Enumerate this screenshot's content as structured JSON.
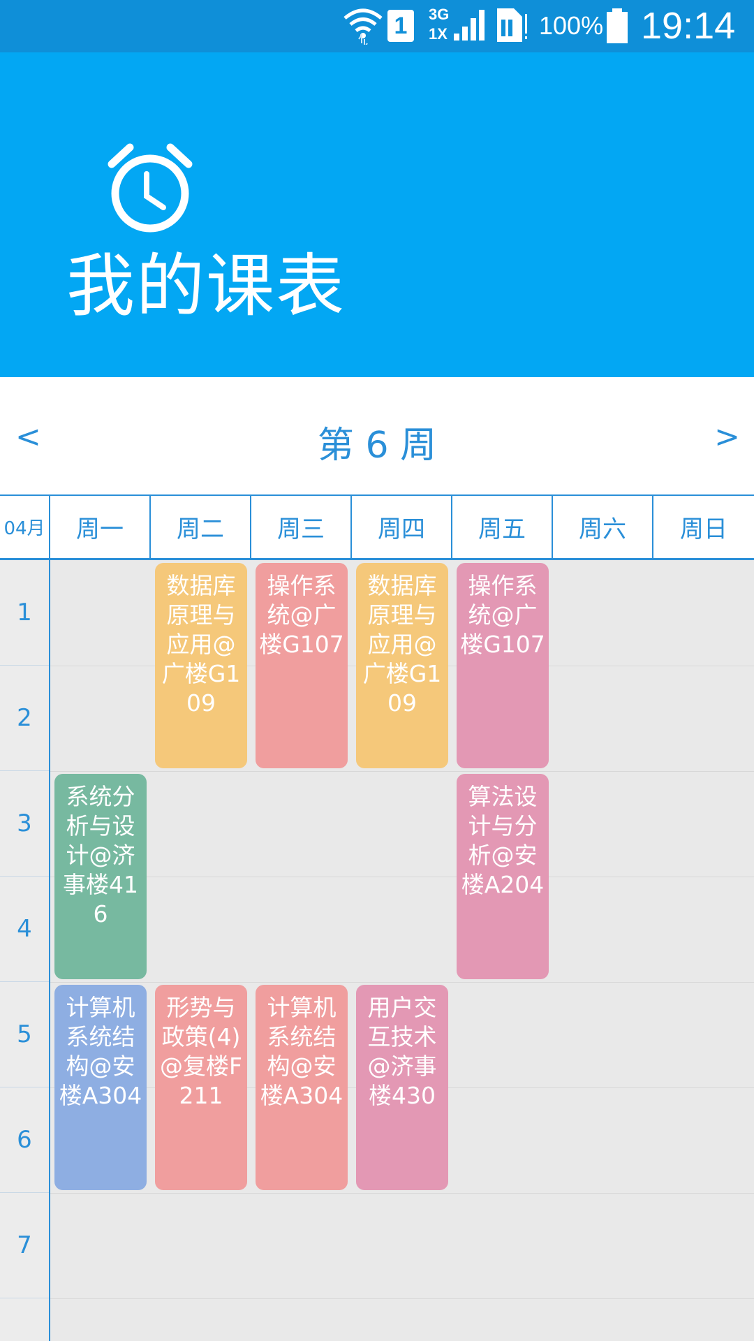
{
  "status_bar": {
    "sim_slot": "1",
    "net_top": "3G",
    "net_bottom": "1X",
    "battery": "100%",
    "time": "19:14"
  },
  "header": {
    "title": "我的课表",
    "icon": "alarm-clock-icon",
    "background": "#03a7f3"
  },
  "week_nav": {
    "prev": "<",
    "label": "第 6 周",
    "next": ">"
  },
  "day_header": {
    "month": "04月",
    "days": [
      "周一",
      "周二",
      "周三",
      "周四",
      "周五",
      "周六",
      "周日"
    ]
  },
  "periods": [
    "1",
    "2",
    "3",
    "4",
    "5",
    "6",
    "7"
  ],
  "courses": [
    {
      "day": 1,
      "start": 1,
      "span": 2,
      "text": "数据库原理与应用@广楼G109",
      "color": "#f5c87a"
    },
    {
      "day": 2,
      "start": 1,
      "span": 2,
      "text": "操作系统@广楼G107",
      "color": "#f09e9e"
    },
    {
      "day": 3,
      "start": 1,
      "span": 2,
      "text": "数据库原理与应用@广楼G109",
      "color": "#f5c87a"
    },
    {
      "day": 4,
      "start": 1,
      "span": 2,
      "text": "操作系统@广楼G107",
      "color": "#e398b4"
    },
    {
      "day": 0,
      "start": 3,
      "span": 2,
      "text": "系统分析与设计@济事楼416",
      "color": "#77b9a0"
    },
    {
      "day": 4,
      "start": 3,
      "span": 2,
      "text": "算法设计与分析@安楼A204",
      "color": "#e398b4"
    },
    {
      "day": 0,
      "start": 5,
      "span": 2,
      "text": "计算机系统结构@安楼A304",
      "color": "#8eaee2"
    },
    {
      "day": 1,
      "start": 5,
      "span": 2,
      "text": "形势与政策(4)@复楼F211",
      "color": "#f09e9e"
    },
    {
      "day": 2,
      "start": 5,
      "span": 2,
      "text": "计算机系统结构@安楼A304",
      "color": "#f09e9e"
    },
    {
      "day": 3,
      "start": 5,
      "span": 2,
      "text": "用户交互技术@济事楼430",
      "color": "#e398b4"
    }
  ]
}
